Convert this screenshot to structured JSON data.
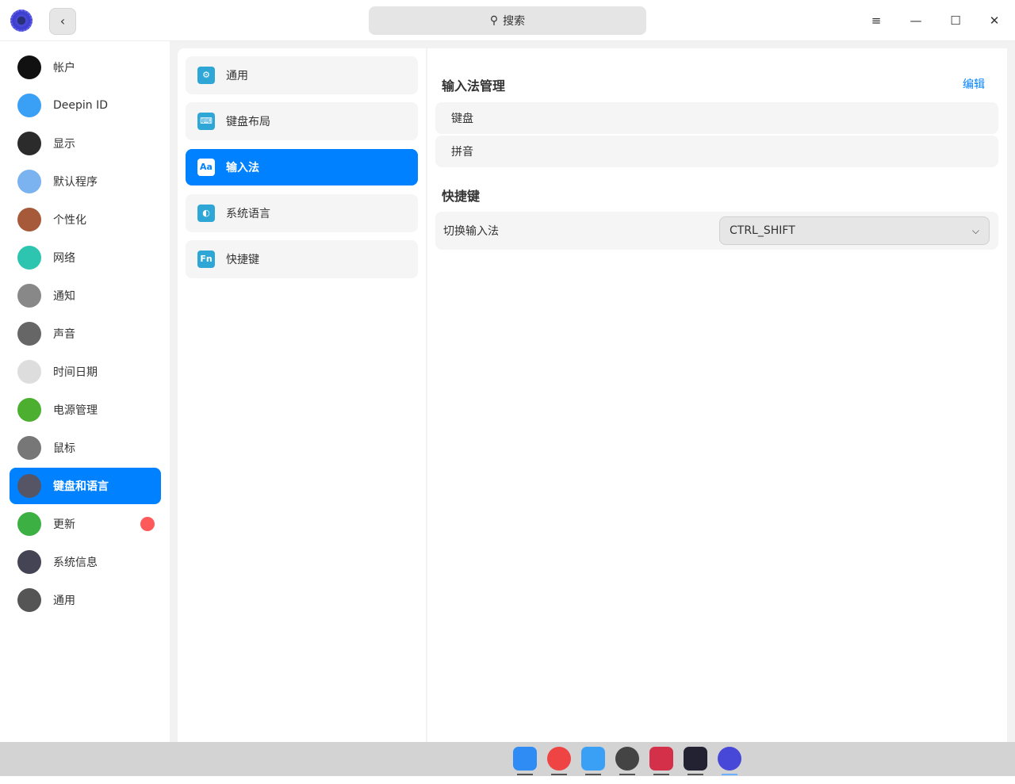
{
  "titlebar": {
    "search_placeholder": "搜索",
    "search_icon": "search-icon"
  },
  "sidebar": {
    "items": [
      {
        "label": "帐户",
        "icon": "account-icon",
        "color": "#111"
      },
      {
        "label": "Deepin ID",
        "icon": "cloud-icon",
        "color": "#3aa0f5"
      },
      {
        "label": "显示",
        "icon": "display-icon",
        "color": "#2b2b2b"
      },
      {
        "label": "默认程序",
        "icon": "default-apps-icon",
        "color": "#7ab3f0"
      },
      {
        "label": "个性化",
        "icon": "personalization-icon",
        "color": "#a65a3a"
      },
      {
        "label": "网络",
        "icon": "network-icon",
        "color": "#2dc5b0"
      },
      {
        "label": "通知",
        "icon": "bell-icon",
        "color": "#888"
      },
      {
        "label": "声音",
        "icon": "speaker-icon",
        "color": "#666"
      },
      {
        "label": "时间日期",
        "icon": "clock-icon",
        "color": "#ddd"
      },
      {
        "label": "电源管理",
        "icon": "battery-icon",
        "color": "#4caf30"
      },
      {
        "label": "鼠标",
        "icon": "mouse-icon",
        "color": "#777"
      },
      {
        "label": "键盘和语言",
        "icon": "keyboard-icon",
        "color": "#556"
      },
      {
        "label": "更新",
        "icon": "update-icon",
        "color": "#3cb043"
      },
      {
        "label": "系统信息",
        "icon": "system-info-icon",
        "color": "#445"
      },
      {
        "label": "通用",
        "icon": "general-icon",
        "color": "#555"
      }
    ],
    "selected": 11
  },
  "middle": {
    "items": [
      {
        "label": "通用",
        "icon": "gear-icon",
        "glyph": "⚙"
      },
      {
        "label": "键盘布局",
        "icon": "keyboard-layout-icon",
        "glyph": "⌨"
      },
      {
        "label": "输入法",
        "icon": "input-method-icon",
        "glyph": "Aa"
      },
      {
        "label": "系统语言",
        "icon": "globe-icon",
        "glyph": "◐"
      },
      {
        "label": "快捷键",
        "icon": "fn-key-icon",
        "glyph": "Fn"
      }
    ],
    "selected": 2
  },
  "content": {
    "title": "输入法管理",
    "edit_label": "编辑",
    "input_methods": [
      "键盘",
      "拼音"
    ],
    "shortcut_title": "快捷键",
    "switch_label": "切换输入法",
    "switch_value": "CTRL_SHIFT"
  },
  "dock": {
    "apps": [
      "file-manager-icon",
      "chrome-icon",
      "chat-icon",
      "gitkraken-icon",
      "terminal-icon",
      "vscode-icon",
      "control-center-icon"
    ]
  },
  "colors": {
    "accent": "#0081ff",
    "badge": "#ff5a5a"
  }
}
